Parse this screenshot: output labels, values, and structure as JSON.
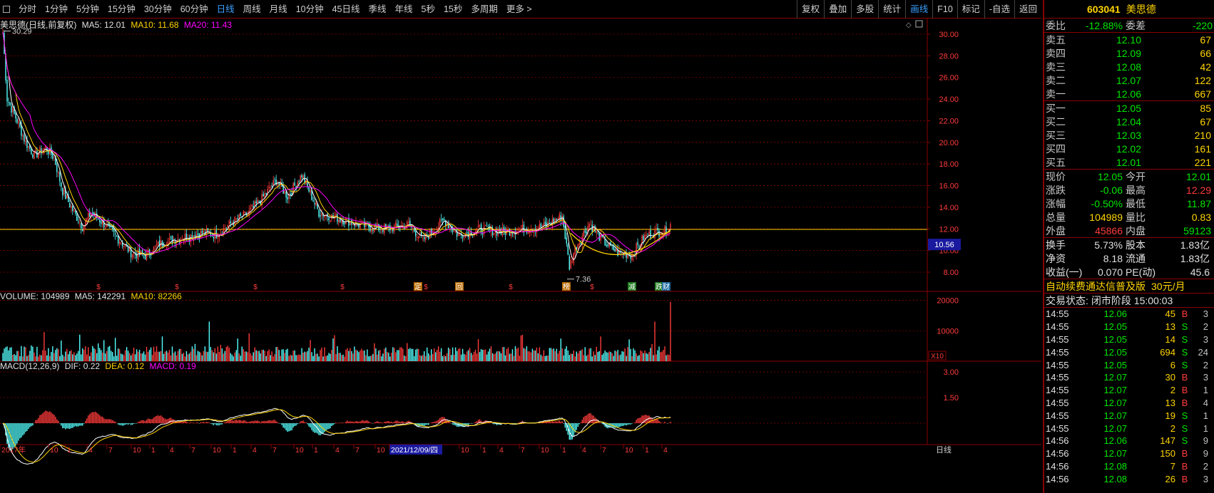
{
  "toolbar": {
    "items": [
      "分时",
      "1分钟",
      "5分钟",
      "15分钟",
      "30分钟",
      "60分钟",
      "日线",
      "周线",
      "月线",
      "10分钟",
      "45日线",
      "季线",
      "年线",
      "5秒",
      "15秒",
      "多周期",
      "更多 >"
    ],
    "active": "日线",
    "right_items": [
      "复权",
      "叠加",
      "多股",
      "统计",
      "画线",
      "F10",
      "标记",
      "-自选",
      "返回"
    ],
    "right_active": "画线"
  },
  "main_legend": {
    "title": "美思德(日线,前复权)",
    "ma5": "MA5: 12.01",
    "ma10": "MA10: 11.68",
    "ma20": "MA20: 11.43"
  },
  "volume_legend": {
    "volume": "VOLUME: 104989",
    "ma5": "MA5: 142291",
    "ma10": "MA10: 82266"
  },
  "macd_legend": {
    "name": "MACD(12,26,9)",
    "dif": "DIF: 0.22",
    "dea": "DEA: 0.12",
    "macd": "MACD: 0.19"
  },
  "price_axis": [
    "30.00",
    "28.00",
    "26.00",
    "24.00",
    "22.00",
    "20.00",
    "18.00",
    "16.00",
    "14.00",
    "12.00",
    "10.00",
    "8.00"
  ],
  "price_tag": "10.56",
  "volume_axis": [
    "20000",
    "10000"
  ],
  "volume_unit": "X10",
  "macd_axis": [
    "3.00",
    "1.50"
  ],
  "annotations": {
    "high_label": "30.29",
    "low_label": "7.36",
    "events": [
      "$",
      "$",
      "$",
      "$",
      "定",
      "$",
      "回",
      "$",
      "榜",
      "$",
      "减",
      "跌",
      "财"
    ]
  },
  "time_axis": {
    "labels": [
      "2017年",
      "10",
      "1",
      "4",
      "7",
      "10",
      "1",
      "4",
      "7",
      "10",
      "1",
      "4",
      "7",
      "10",
      "1",
      "4",
      "7",
      "10",
      "2021/12/09/四",
      "10",
      "1",
      "4",
      "7",
      "10",
      "1",
      "4",
      "7",
      "10",
      "1",
      "4"
    ],
    "period_label": "日线"
  },
  "quote": {
    "code": "603041",
    "name": "美思德",
    "weibi_label": "委比",
    "weibi": "-12.88%",
    "weicha_label": "委差",
    "weicha": "-220",
    "asks": [
      {
        "label": "卖五",
        "price": "12.10",
        "vol": "67"
      },
      {
        "label": "卖四",
        "price": "12.09",
        "vol": "66"
      },
      {
        "label": "卖三",
        "price": "12.08",
        "vol": "42"
      },
      {
        "label": "卖二",
        "price": "12.07",
        "vol": "122"
      },
      {
        "label": "卖一",
        "price": "12.06",
        "vol": "667"
      }
    ],
    "bids": [
      {
        "label": "买一",
        "price": "12.05",
        "vol": "85"
      },
      {
        "label": "买二",
        "price": "12.04",
        "vol": "67"
      },
      {
        "label": "买三",
        "price": "12.03",
        "vol": "210"
      },
      {
        "label": "买四",
        "price": "12.02",
        "vol": "161"
      },
      {
        "label": "买五",
        "price": "12.01",
        "vol": "221"
      }
    ],
    "stats": [
      {
        "l1": "现价",
        "v1": "12.05",
        "c1": "green",
        "l2": "今开",
        "v2": "12.01",
        "c2": "green"
      },
      {
        "l1": "涨跌",
        "v1": "-0.06",
        "c1": "green",
        "l2": "最高",
        "v2": "12.29",
        "c2": "red"
      },
      {
        "l1": "涨幅",
        "v1": "-0.50%",
        "c1": "green",
        "l2": "最低",
        "v2": "11.87",
        "c2": "green"
      },
      {
        "l1": "总量",
        "v1": "104989",
        "c1": "yellow",
        "l2": "量比",
        "v2": "0.83",
        "c2": "yellow"
      },
      {
        "l1": "外盘",
        "v1": "45866",
        "c1": "red",
        "l2": "内盘",
        "v2": "59123",
        "c2": "green"
      }
    ],
    "stats2": [
      {
        "l1": "换手",
        "v1": "5.73%",
        "l2": "股本",
        "v2": "1.83亿"
      },
      {
        "l1": "净资",
        "v1": "8.18",
        "l2": "流通",
        "v2": "1.83亿"
      },
      {
        "l1": "收益(一)",
        "v1": "0.070",
        "l2": "PE(动)",
        "v2": "45.6"
      }
    ],
    "ad_text": "自动续费通达信普及版",
    "ad_price": "30元/月",
    "status_label": "交易状态:",
    "status_value": "闭市阶段 15:00:03",
    "trades": [
      {
        "t": "14:55",
        "p": "12.06",
        "pc": "green",
        "v": "45",
        "bs": "B",
        "n": "3"
      },
      {
        "t": "14:55",
        "p": "12.05",
        "pc": "green",
        "v": "13",
        "bs": "S",
        "n": "2"
      },
      {
        "t": "14:55",
        "p": "12.05",
        "pc": "green",
        "v": "14",
        "bs": "S",
        "n": "3"
      },
      {
        "t": "14:55",
        "p": "12.05",
        "pc": "green",
        "v": "694",
        "bs": "S",
        "n": "24",
        "vc": "magenta"
      },
      {
        "t": "14:55",
        "p": "12.05",
        "pc": "green",
        "v": "6",
        "bs": "S",
        "n": "2"
      },
      {
        "t": "14:55",
        "p": "12.07",
        "pc": "green",
        "v": "30",
        "bs": "B",
        "n": "3"
      },
      {
        "t": "14:55",
        "p": "12.07",
        "pc": "green",
        "v": "2",
        "bs": "B",
        "n": "1"
      },
      {
        "t": "14:55",
        "p": "12.07",
        "pc": "green",
        "v": "13",
        "bs": "B",
        "n": "4"
      },
      {
        "t": "14:55",
        "p": "12.07",
        "pc": "green",
        "v": "19",
        "bs": "S",
        "n": "1"
      },
      {
        "t": "14:55",
        "p": "12.07",
        "pc": "green",
        "v": "2",
        "bs": "S",
        "n": "1"
      },
      {
        "t": "14:56",
        "p": "12.06",
        "pc": "green",
        "v": "147",
        "bs": "S",
        "n": "9"
      },
      {
        "t": "14:56",
        "p": "12.07",
        "pc": "green",
        "v": "150",
        "bs": "B",
        "n": "9"
      },
      {
        "t": "14:56",
        "p": "12.08",
        "pc": "green",
        "v": "7",
        "bs": "B",
        "n": "2"
      },
      {
        "t": "14:56",
        "p": "12.08",
        "pc": "green",
        "v": "26",
        "bs": "B",
        "n": "3"
      }
    ]
  },
  "colors": {
    "grid": "#8a0000",
    "up": "#ff3b3b",
    "down": "#54ffff",
    "ma5": "#ffffff",
    "ma10": "#ffd400",
    "ma20": "#ff00ff",
    "support_line": "#ffd400"
  }
}
